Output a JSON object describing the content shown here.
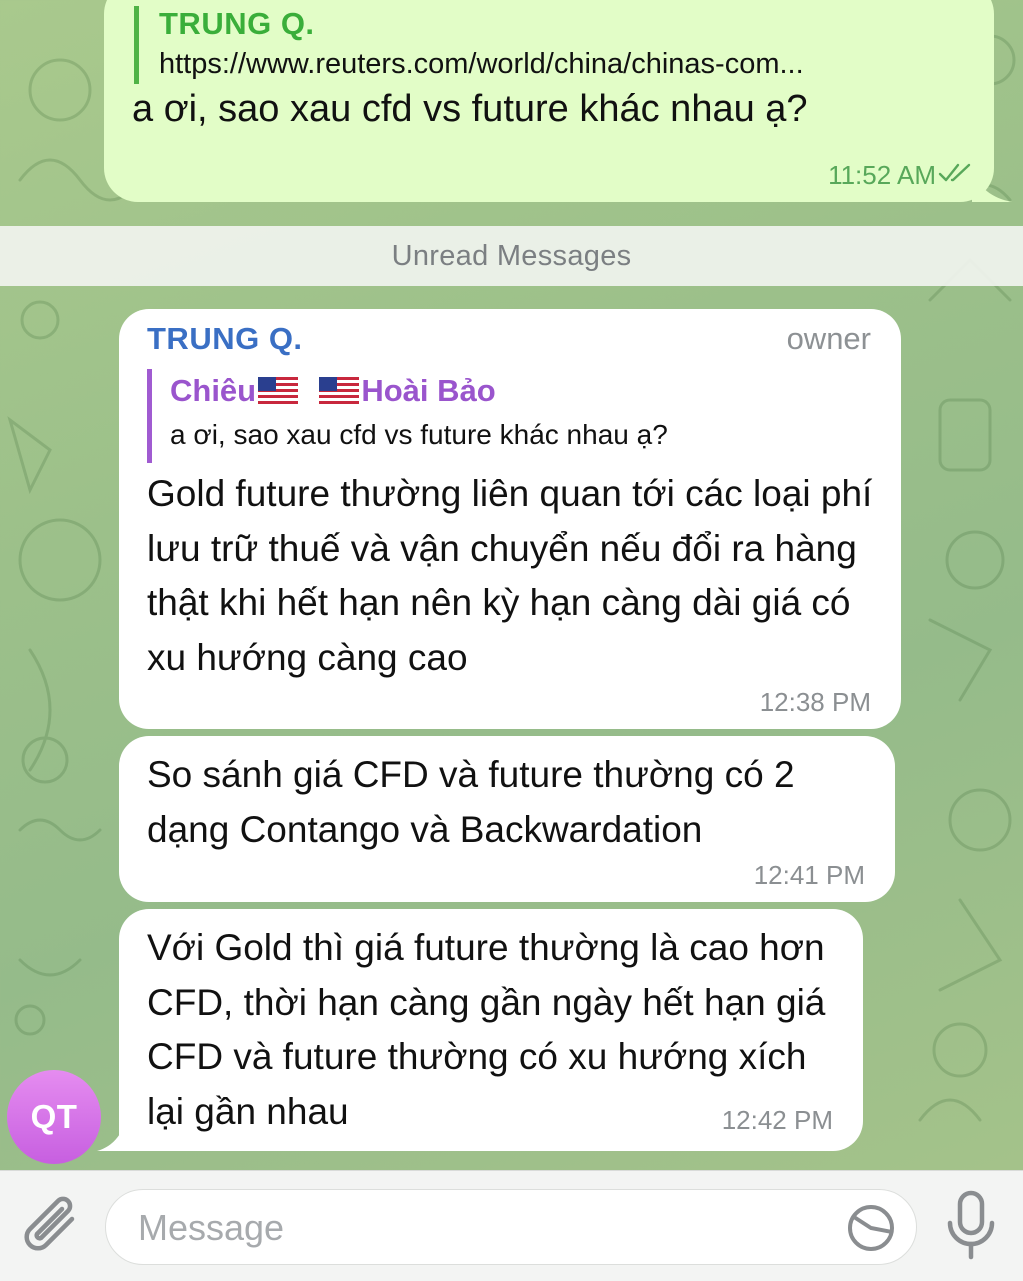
{
  "outgoing_message": {
    "reply": {
      "sender": "TRUNG Q.",
      "text": "https://www.reuters.com/world/china/chinas-com..."
    },
    "text": "a ơi, sao xau cfd vs future khác nhau ạ?",
    "time": "11:52 AM",
    "status_icon": "double-check-icon"
  },
  "divider": {
    "label": "Unread Messages"
  },
  "incoming_messages": [
    {
      "sender": "TRUNG Q.",
      "role": "owner",
      "reply": {
        "name_first": "Chiêu",
        "name_second": "Hoài Bảo",
        "text": "a ơi, sao xau cfd vs future khác nhau ạ?"
      },
      "text": "Gold future thường liên quan tới các loại phí lưu trữ thuế và vận chuyển nếu đổi ra hàng thật khi hết hạn nên kỳ hạn càng dài giá có xu hướng càng cao",
      "time": "12:38 PM"
    },
    {
      "text": "So sánh giá CFD và future thường có 2 dạng Contango và Backwardation",
      "time": "12:41 PM"
    },
    {
      "text": "Với Gold thì giá future thường là cao hơn CFD, thời hạn càng gần ngày hết hạn giá CFD và future thường có xu hướng xích lại gần nhau",
      "time": "12:42 PM"
    }
  ],
  "avatar": {
    "initials": "QT"
  },
  "input_bar": {
    "placeholder": "Message",
    "value": ""
  },
  "colors": {
    "outgoing_bubble": "#e2fdc7",
    "outgoing_accent": "#3aae3a",
    "incoming_bubble": "#ffffff",
    "sender_name": "#3a6fc4",
    "reply_accent": "#9a55cd",
    "avatar_gradient_top": "#e58cf0",
    "avatar_gradient_bottom": "#c75fe0"
  }
}
